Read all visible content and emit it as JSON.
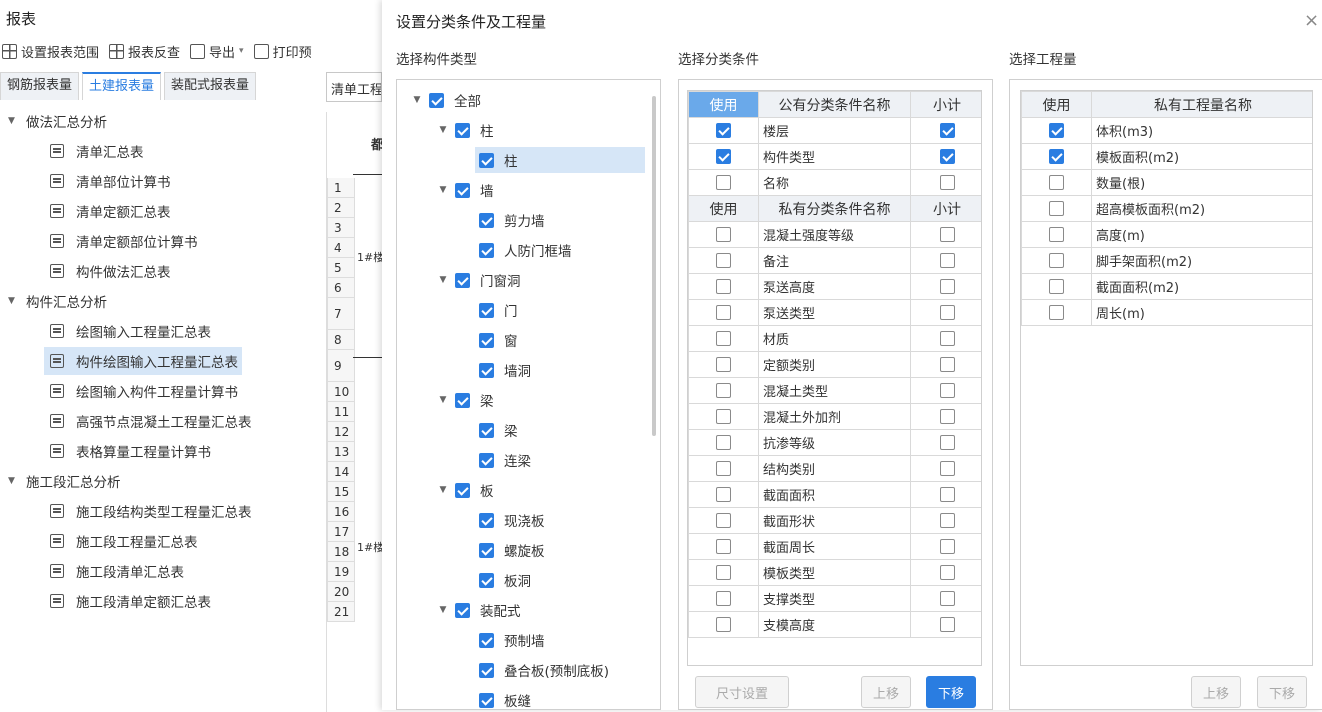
{
  "app": {
    "title": "报表",
    "toolbar": [
      {
        "label": "设置报表范围",
        "icon": "grid-icon"
      },
      {
        "label": "报表反查",
        "icon": "search-table-icon"
      },
      {
        "label": "导出",
        "icon": "export-icon"
      },
      {
        "label": "打印预",
        "icon": "print-icon"
      }
    ],
    "tabs": [
      "钢筋报表量",
      "土建报表量",
      "装配式报表量"
    ],
    "active_tab": "土建报表量",
    "field_value": "清单工程",
    "tree": [
      {
        "type": "group",
        "label": "做法汇总分析"
      },
      {
        "type": "leaf",
        "label": "清单汇总表"
      },
      {
        "type": "leaf",
        "label": "清单部位计算书"
      },
      {
        "type": "leaf",
        "label": "清单定额汇总表"
      },
      {
        "type": "leaf",
        "label": "清单定额部位计算书"
      },
      {
        "type": "leaf",
        "label": "构件做法汇总表"
      },
      {
        "type": "group",
        "label": "构件汇总分析"
      },
      {
        "type": "leaf",
        "label": "绘图输入工程量汇总表"
      },
      {
        "type": "leaf",
        "label": "构件绘图输入工程量汇总表",
        "selected": true
      },
      {
        "type": "leaf",
        "label": "绘图输入构件工程量计算书"
      },
      {
        "type": "leaf",
        "label": "高强节点混凝土工程量汇总表"
      },
      {
        "type": "leaf",
        "label": "表格算量工程量计算书"
      },
      {
        "type": "group",
        "label": "施工段汇总分析"
      },
      {
        "type": "leaf",
        "label": "施工段结构类型工程量汇总表"
      },
      {
        "type": "leaf",
        "label": "施工段工程量汇总表"
      },
      {
        "type": "leaf",
        "label": "施工段清单汇总表"
      },
      {
        "type": "leaf",
        "label": "施工段清单定额汇总表"
      }
    ],
    "row_numbers": [
      "1",
      "2",
      "3",
      "4",
      "5",
      "6",
      "7",
      "8",
      "9",
      "10",
      "11",
      "12",
      "13",
      "14",
      "15",
      "16",
      "17",
      "18",
      "19",
      "20",
      "21"
    ],
    "cell_fragments": [
      "都",
      "1#楼",
      "1#楼"
    ]
  },
  "dialog": {
    "title": "设置分类条件及工程量",
    "close": "×",
    "sections": {
      "types": "选择构件类型",
      "conditions": "选择分类条件",
      "quantities": "选择工程量"
    },
    "type_tree": [
      {
        "label": "全部",
        "level": 0,
        "arrow": true
      },
      {
        "label": "柱",
        "level": 1,
        "arrow": true
      },
      {
        "label": "柱",
        "level": 2,
        "selected": true
      },
      {
        "label": "墙",
        "level": 1,
        "arrow": true
      },
      {
        "label": "剪力墙",
        "level": 2
      },
      {
        "label": "人防门框墙",
        "level": 2
      },
      {
        "label": "门窗洞",
        "level": 1,
        "arrow": true
      },
      {
        "label": "门",
        "level": 2
      },
      {
        "label": "窗",
        "level": 2
      },
      {
        "label": "墙洞",
        "level": 2
      },
      {
        "label": "梁",
        "level": 1,
        "arrow": true
      },
      {
        "label": "梁",
        "level": 2
      },
      {
        "label": "连梁",
        "level": 2
      },
      {
        "label": "板",
        "level": 1,
        "arrow": true
      },
      {
        "label": "现浇板",
        "level": 2
      },
      {
        "label": "螺旋板",
        "level": 2
      },
      {
        "label": "板洞",
        "level": 2
      },
      {
        "label": "装配式",
        "level": 1,
        "arrow": true
      },
      {
        "label": "预制墙",
        "level": 2
      },
      {
        "label": "叠合板(预制底板)",
        "level": 2
      },
      {
        "label": "板缝",
        "level": 2
      }
    ],
    "public_header": {
      "use": "使用",
      "name": "公有分类条件名称",
      "subtotal": "小计"
    },
    "public_rows": [
      {
        "name": "楼层",
        "use": true,
        "subtotal": true
      },
      {
        "name": "构件类型",
        "use": true,
        "subtotal": true
      },
      {
        "name": "名称",
        "use": false,
        "subtotal": false
      }
    ],
    "private_header": {
      "use": "使用",
      "name": "私有分类条件名称",
      "subtotal": "小计"
    },
    "private_rows": [
      "混凝土强度等级",
      "备注",
      "泵送高度",
      "泵送类型",
      "材质",
      "定额类别",
      "混凝土类型",
      "混凝土外加剂",
      "抗渗等级",
      "结构类别",
      "截面面积",
      "截面形状",
      "截面周长",
      "模板类型",
      "支撑类型",
      "支模高度"
    ],
    "cond_buttons": {
      "size": "尺寸设置",
      "up": "上移",
      "down": "下移"
    },
    "qty_header": {
      "use": "使用",
      "name": "私有工程量名称"
    },
    "qty_rows": [
      {
        "name": "体积(m3)",
        "use": true
      },
      {
        "name": "模板面积(m2)",
        "use": true
      },
      {
        "name": "数量(根)",
        "use": false
      },
      {
        "name": "超高模板面积(m2)",
        "use": false
      },
      {
        "name": "高度(m)",
        "use": false
      },
      {
        "name": "脚手架面积(m2)",
        "use": false
      },
      {
        "name": "截面面积(m2)",
        "use": false
      },
      {
        "name": "周长(m)",
        "use": false
      }
    ],
    "qty_buttons": {
      "up": "上移",
      "down": "下移"
    },
    "colors": {
      "accent": "#2a7de1",
      "header_blue": "#6aa9ea",
      "selection": "#d6e6f7"
    }
  }
}
